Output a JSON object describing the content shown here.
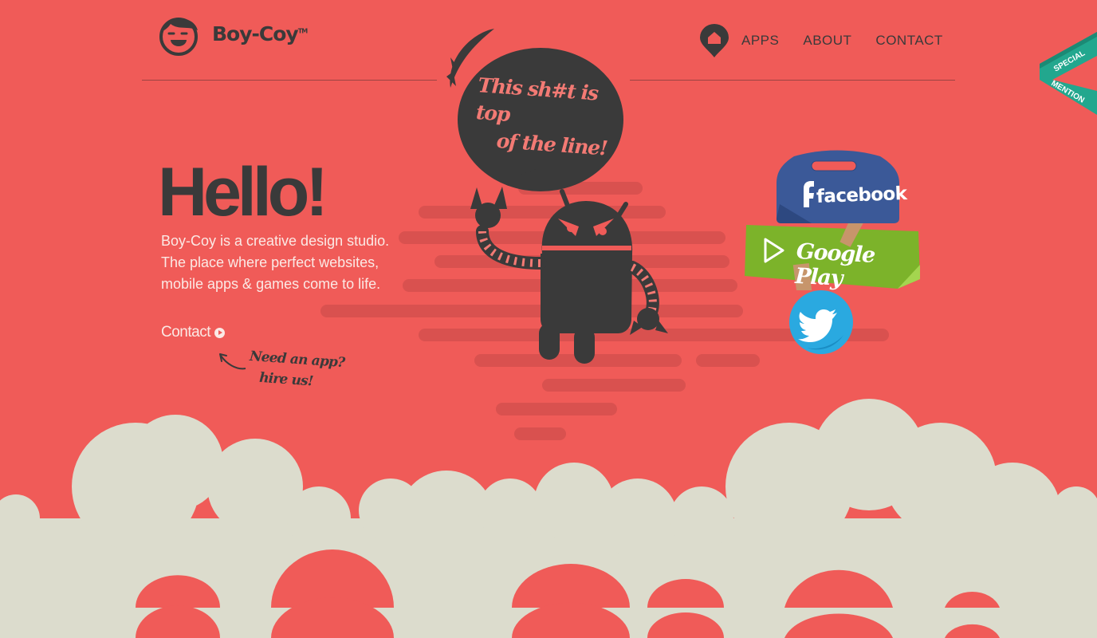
{
  "header": {
    "logo_text": "Boy-Coy",
    "logo_mark": "TM",
    "nav": [
      {
        "label": "APPS"
      },
      {
        "label": "ABOUT"
      },
      {
        "label": "CONTACT"
      }
    ]
  },
  "ribbon": {
    "line1": "SPECIAL",
    "line2": "MENTION"
  },
  "hero": {
    "title": "Hello!",
    "intro": "Boy-Coy is a creative design studio. The place where perfect websites, mobile apps & games come to life.",
    "contact_label": "Contact",
    "hire_line1": "Need an app?",
    "hire_line2": "hire us!",
    "bubble_line1": "This sh#t is top",
    "bubble_line2": "of the line!"
  },
  "social": {
    "facebook": "facebook",
    "google_play": "Google Play",
    "twitter_icon": "twitter-bird-icon"
  },
  "colors": {
    "background": "#f05b58",
    "dark": "#3a3a3a",
    "cloud": "#dcdccd",
    "facebook": "#3b5998",
    "google_play": "#7cb32a",
    "twitter": "#2aa9e0",
    "ribbon": "#22a78e"
  }
}
